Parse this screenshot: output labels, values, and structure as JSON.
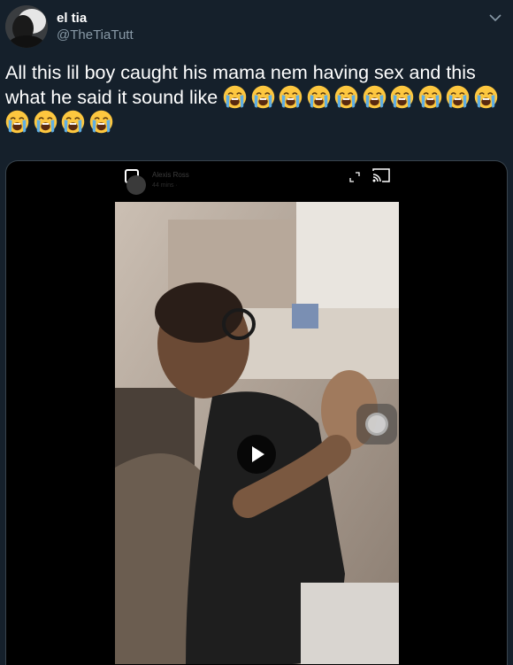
{
  "tweet": {
    "display_name": "el tia",
    "handle": "@TheTiaTutt",
    "text": "All this lil boy caught his mama nem having sex and this what he said it sound like",
    "emoji_icon": "loudly-crying-face-icon",
    "emoji_count": 14
  },
  "video": {
    "inner_author": "Alexis Ross",
    "inner_time": "44 mins ·"
  },
  "colors": {
    "background": "#15202b",
    "text": "#ffffff",
    "secondary_text": "#8899a6",
    "border": "#38444d",
    "emoji_face": "#fdc73f",
    "emoji_tear": "#5faee3"
  }
}
